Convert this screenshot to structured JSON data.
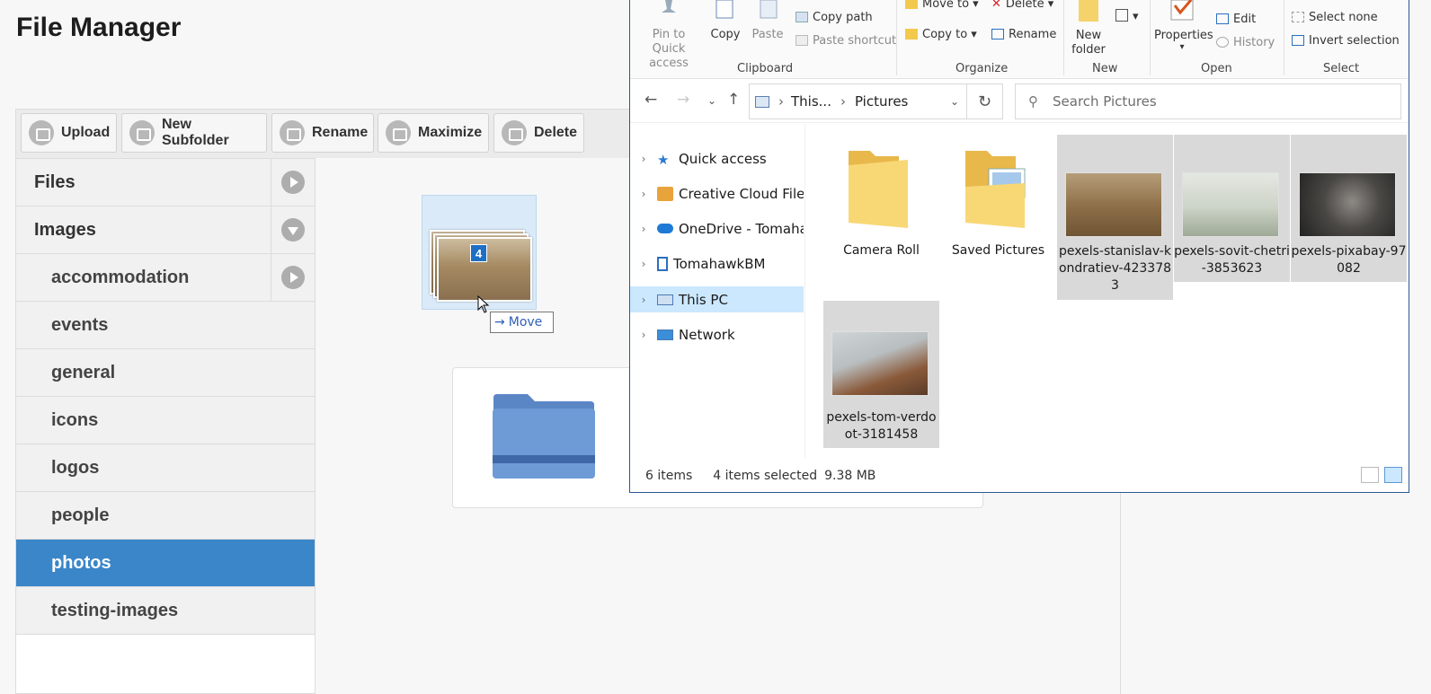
{
  "app": {
    "title": "File Manager"
  },
  "toolbar": {
    "buttons": [
      {
        "label": "Upload",
        "icon": "upload-icon"
      },
      {
        "label": "New Subfolder",
        "icon": "new-folder-icon"
      },
      {
        "label": "Rename",
        "icon": "rename-icon"
      },
      {
        "label": "Maximize",
        "icon": "maximize-icon"
      },
      {
        "label": "Delete",
        "icon": "delete-icon"
      }
    ]
  },
  "sidebar": {
    "items": [
      {
        "label": "Files",
        "level": "top",
        "arrow": "right"
      },
      {
        "label": "Images",
        "level": "top",
        "arrow": "down"
      },
      {
        "label": "accommodation",
        "level": "sub",
        "arrow": "right"
      },
      {
        "label": "events",
        "level": "sub"
      },
      {
        "label": "general",
        "level": "sub"
      },
      {
        "label": "icons",
        "level": "sub"
      },
      {
        "label": "logos",
        "level": "sub"
      },
      {
        "label": "people",
        "level": "sub"
      },
      {
        "label": "photos",
        "level": "sub",
        "active": true
      },
      {
        "label": "testing-images",
        "level": "sub"
      }
    ]
  },
  "drag": {
    "count": "4",
    "tooltip": "Move"
  },
  "explorer": {
    "ribbon": {
      "clipboard": {
        "label": "Clipboard",
        "pin": "Pin to Quick access",
        "copy": "Copy",
        "paste": "Paste",
        "copy_path": "Copy path",
        "paste_shortcut": "Paste shortcut"
      },
      "organize": {
        "label": "Organize",
        "move_to": "Move to",
        "copy_to": "Copy to",
        "delete": "Delete",
        "rename": "Rename"
      },
      "new": {
        "label": "New",
        "new_folder": "New folder"
      },
      "open": {
        "label": "Open",
        "properties": "Properties",
        "edit": "Edit",
        "history": "History"
      },
      "select": {
        "label": "Select",
        "select_none": "Select none",
        "invert_selection": "Invert selection"
      }
    },
    "address": {
      "segments": [
        "This...",
        "Pictures"
      ],
      "search_placeholder": "Search Pictures"
    },
    "nav": [
      {
        "label": "Quick access",
        "icon": "star-icon"
      },
      {
        "label": "Creative Cloud Files",
        "icon": "creative-cloud-icon"
      },
      {
        "label": "OneDrive - Tomahaw",
        "icon": "onedrive-cloud-icon"
      },
      {
        "label": "TomahawkBM",
        "icon": "building-icon"
      },
      {
        "label": "This PC",
        "icon": "computer-icon",
        "selected": true
      },
      {
        "label": "Network",
        "icon": "network-icon"
      }
    ],
    "files": [
      {
        "name": "Camera Roll",
        "type": "folder"
      },
      {
        "name": "Saved Pictures",
        "type": "folder"
      },
      {
        "name": "pexels-stanislav-kondratiev-4233783",
        "type": "image",
        "selected": true
      },
      {
        "name": "pexels-sovit-chetri-3853623",
        "type": "image",
        "selected": true
      },
      {
        "name": "pexels-pixabay-97082",
        "type": "image",
        "selected": true
      },
      {
        "name": "pexels-tom-verdoot-3181458",
        "type": "image",
        "selected": true
      }
    ],
    "status": {
      "count": "6 items",
      "selected": "4 items selected",
      "size": "9.38 MB"
    }
  },
  "colors": {
    "accent": "#3a86c8",
    "selection": "#cce8ff",
    "selected_tile": "#d9d9d9"
  }
}
